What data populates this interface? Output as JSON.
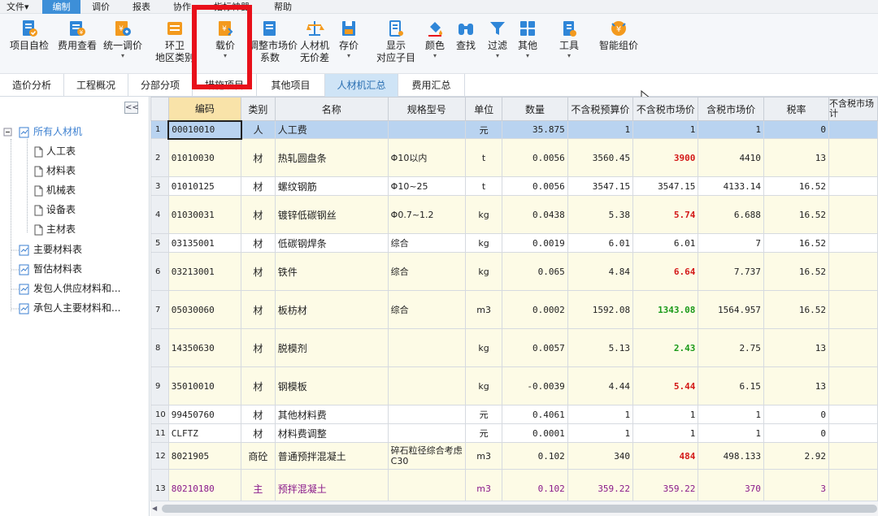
{
  "menubar": {
    "items": [
      "文件▾",
      "编制",
      "调价",
      "报表",
      "协作",
      "指标神器",
      "帮助"
    ],
    "active": "编制"
  },
  "ribbon": {
    "buttons": [
      {
        "label": "项目自检",
        "icon": "check-doc-icon"
      },
      {
        "label": "费用查看",
        "icon": "cost-view-icon"
      },
      {
        "label": "统一调价",
        "icon": "unify-price-icon",
        "caret": "▾"
      },
      {
        "label": "环卫",
        "sub": "地区类别",
        "icon": "sanitation-icon"
      },
      {
        "label": "载价",
        "icon": "load-price-icon",
        "caret": "▾"
      },
      {
        "label": "调整市场价",
        "sub": "系数",
        "icon": "adjust-market-icon"
      },
      {
        "label": "人材机",
        "sub": "无价差",
        "icon": "scale-icon"
      },
      {
        "label": "存价",
        "icon": "save-price-icon",
        "caret": "▾"
      },
      {
        "label": "显示",
        "sub": "对应子目",
        "icon": "show-items-icon"
      },
      {
        "label": "颜色",
        "icon": "paint-bucket-icon",
        "caret": "▾"
      },
      {
        "label": "查找",
        "icon": "binoculars-icon"
      },
      {
        "label": "过滤",
        "icon": "filter-icon",
        "caret": "▾"
      },
      {
        "label": "其他",
        "icon": "grid-other-icon",
        "caret": "▾"
      },
      {
        "label": "工具",
        "icon": "tools-icon",
        "caret": "▾"
      },
      {
        "label": "智能组价",
        "icon": "smart-price-icon"
      }
    ]
  },
  "tabs": {
    "items": [
      "造价分析",
      "工程概况",
      "分部分项",
      "措施项目",
      "其他项目",
      "人材机汇总",
      "费用汇总"
    ],
    "active": "人材机汇总"
  },
  "sidebar": {
    "collapse_label": "<<",
    "tree": [
      {
        "label": "所有人材机",
        "level": 0,
        "selected": true
      },
      {
        "label": "人工表",
        "level": 1
      },
      {
        "label": "材料表",
        "level": 1
      },
      {
        "label": "机械表",
        "level": 1
      },
      {
        "label": "设备表",
        "level": 1
      },
      {
        "label": "主材表",
        "level": 1
      },
      {
        "label": "主要材料表",
        "level": 0
      },
      {
        "label": "暂估材料表",
        "level": 0
      },
      {
        "label": "发包人供应材料和...",
        "level": 0
      },
      {
        "label": "承包人主要材料和...",
        "level": 0
      }
    ]
  },
  "grid": {
    "headers": [
      "编码",
      "类别",
      "名称",
      "规格型号",
      "单位",
      "数量",
      "不含税预算价",
      "不含税市场价",
      "含税市场价",
      "税率",
      "不含税市场\n计"
    ],
    "rows": [
      {
        "no": "1",
        "code": "00010010",
        "type": "人",
        "name": "人工费",
        "spec": "",
        "unit": "元",
        "qty": "35.875",
        "budget": "1",
        "market": "1",
        "taxed": "1",
        "rate": "0",
        "h": 22
      },
      {
        "no": "2",
        "code": "01010030",
        "type": "材",
        "name": "热轧圆盘条",
        "spec": "Φ10以内",
        "unit": "t",
        "qty": "0.0056",
        "budget": "3560.45",
        "market": "3900",
        "taxed": "4410",
        "rate": "13",
        "h": 47,
        "style": "red"
      },
      {
        "no": "3",
        "code": "01010125",
        "type": "材",
        "name": "螺纹钢筋",
        "spec": "Φ10~25",
        "unit": "t",
        "qty": "0.0056",
        "budget": "3547.15",
        "market": "3547.15",
        "taxed": "4133.14",
        "rate": "16.52",
        "h": 23
      },
      {
        "no": "4",
        "code": "01030031",
        "type": "材",
        "name": "镀锌低碳钢丝",
        "spec": "Φ0.7~1.2",
        "unit": "kg",
        "qty": "0.0438",
        "budget": "5.38",
        "market": "5.74",
        "taxed": "6.688",
        "rate": "16.52",
        "h": 47,
        "style": "red"
      },
      {
        "no": "5",
        "code": "03135001",
        "type": "材",
        "name": "低碳钢焊条",
        "spec": "综合",
        "unit": "kg",
        "qty": "0.0019",
        "budget": "6.01",
        "market": "6.01",
        "taxed": "7",
        "rate": "16.52",
        "h": 23
      },
      {
        "no": "6",
        "code": "03213001",
        "type": "材",
        "name": "铁件",
        "spec": "综合",
        "unit": "kg",
        "qty": "0.065",
        "budget": "4.84",
        "market": "6.64",
        "taxed": "7.737",
        "rate": "16.52",
        "h": 47,
        "style": "red"
      },
      {
        "no": "7",
        "code": "05030060",
        "type": "材",
        "name": "板枋材",
        "spec": "综合",
        "unit": "m3",
        "qty": "0.0002",
        "budget": "1592.08",
        "market": "1343.08",
        "taxed": "1564.957",
        "rate": "16.52",
        "h": 47,
        "style": "green"
      },
      {
        "no": "8",
        "code": "14350630",
        "type": "材",
        "name": "脱模剂",
        "spec": "",
        "unit": "kg",
        "qty": "0.0057",
        "budget": "5.13",
        "market": "2.43",
        "taxed": "2.75",
        "rate": "13",
        "h": 47,
        "style": "green"
      },
      {
        "no": "9",
        "code": "35010010",
        "type": "材",
        "name": "钢模板",
        "spec": "",
        "unit": "kg",
        "qty": "-0.0039",
        "budget": "4.44",
        "market": "5.44",
        "taxed": "6.15",
        "rate": "13",
        "h": 47,
        "style": "red"
      },
      {
        "no": "10",
        "code": "99450760",
        "type": "材",
        "name": "其他材料费",
        "spec": "",
        "unit": "元",
        "qty": "0.4061",
        "budget": "1",
        "market": "1",
        "taxed": "1",
        "rate": "0",
        "h": 23
      },
      {
        "no": "11",
        "code": "CLFTZ",
        "type": "材",
        "name": "材料费调整",
        "spec": "",
        "unit": "元",
        "qty": "0.0001",
        "budget": "1",
        "market": "1",
        "taxed": "1",
        "rate": "0",
        "h": 23
      },
      {
        "no": "12",
        "code": "8021905",
        "type": "商砼",
        "name": "普通预拌混凝土",
        "spec": "碎石粒径综合考虑 C30",
        "unit": "m3",
        "qty": "0.102",
        "budget": "340",
        "market": "484",
        "taxed": "498.133",
        "rate": "2.92",
        "h": 33,
        "style": "red"
      },
      {
        "no": "13",
        "code": "80210180",
        "type": "主",
        "name": "预拌混凝土",
        "spec": "",
        "unit": "m3",
        "qty": "0.102",
        "budget": "359.22",
        "market": "359.22",
        "taxed": "370",
        "rate": "3",
        "h": 47,
        "row_style": "purple"
      }
    ]
  },
  "colors": {
    "accent": "#3d8fd8",
    "highlight": "#e8101a",
    "price_up": "#d31818",
    "price_down": "#1a9a1a",
    "main_material": "#8a1a8a"
  }
}
